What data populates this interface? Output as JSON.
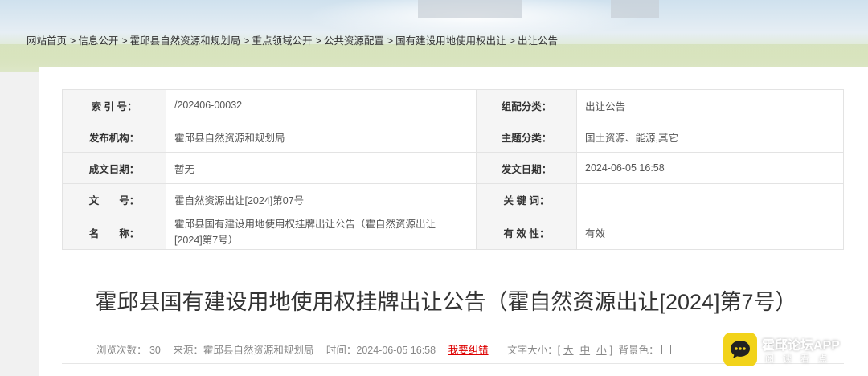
{
  "breadcrumb": [
    "网站首页",
    "信息公开",
    "霍邱县自然资源和规划局",
    "重点领域公开",
    "公共资源配置",
    "国有建设用地使用权出让",
    "出让公告"
  ],
  "breadcrumb_sep": ">",
  "meta": {
    "rows": [
      {
        "k1": "索 引 号：",
        "v1": "/202406-00032",
        "k2": "组配分类：",
        "v2": "出让公告"
      },
      {
        "k1": "发布机构：",
        "v1": "霍邱县自然资源和规划局",
        "k2": "主题分类：",
        "v2": "国土资源、能源,其它"
      },
      {
        "k1": "成文日期：",
        "v1": "暂无",
        "k2": "发文日期：",
        "v2": "2024-06-05 16:58"
      },
      {
        "k1": "文　　号：",
        "v1": "霍自然资源出让[2024]第07号",
        "k2": "关 键 词：",
        "v2": ""
      },
      {
        "k1": "名　　称：",
        "v1": "霍邱县国有建设用地使用权挂牌出让公告（霍自然资源出让[2024]第7号）",
        "k2": "有 效 性：",
        "v2": "有效"
      }
    ]
  },
  "title": "霍邱县国有建设用地使用权挂牌出让公告（霍自然资源出让[2024]第7号）",
  "info": {
    "views": "浏览次数： 30",
    "source": "来源：霍邱县自然资源和规划局",
    "time": "时间：2024-06-05 16:58",
    "error_link": "我要纠错",
    "font_label": "文字大小：[",
    "font_large": "大",
    "font_medium": "中",
    "font_small": "小",
    "font_end": "]",
    "bg_label": "背景色："
  },
  "watermark": {
    "name": "霍邱论坛APP",
    "sub": "阅读看点"
  },
  "colors": {
    "error_link": "#d00000",
    "logo_yellow": "#f2d31a",
    "label_bg": "#f5f5f5"
  }
}
